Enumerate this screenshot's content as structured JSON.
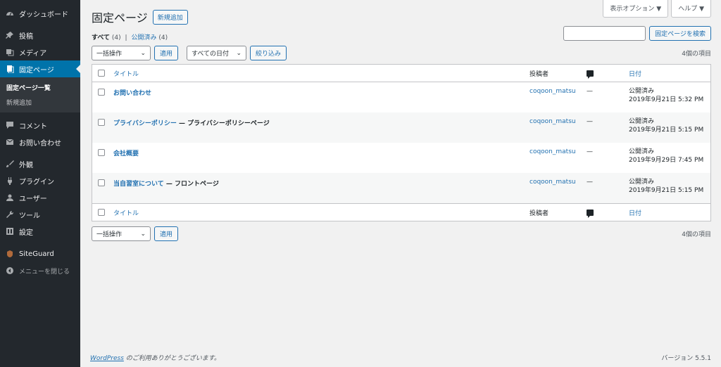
{
  "sidebar": {
    "items": [
      {
        "label": "ダッシュボード",
        "icon": "dashboard-icon"
      },
      {
        "label": "投稿",
        "icon": "pin-icon"
      },
      {
        "label": "メディア",
        "icon": "media-icon"
      },
      {
        "label": "固定ページ",
        "icon": "page-icon"
      },
      {
        "label": "コメント",
        "icon": "comment-icon"
      },
      {
        "label": "お問い合わせ",
        "icon": "mail-icon"
      },
      {
        "label": "外観",
        "icon": "brush-icon"
      },
      {
        "label": "プラグイン",
        "icon": "plugin-icon"
      },
      {
        "label": "ユーザー",
        "icon": "user-icon"
      },
      {
        "label": "ツール",
        "icon": "wrench-icon"
      },
      {
        "label": "設定",
        "icon": "settings-icon"
      },
      {
        "label": "SiteGuard",
        "icon": "siteguard-icon"
      }
    ],
    "submenu": {
      "all_pages": "固定ページ一覧",
      "add_new": "新規追加"
    },
    "collapse": "メニューを閉じる"
  },
  "header": {
    "title": "固定ページ",
    "add_new": "新規追加",
    "screen_options": "表示オプション ▼",
    "help": "ヘルプ ▼"
  },
  "filters": {
    "all": "すべて",
    "all_count": "(4)",
    "separator": "|",
    "published": "公開済み",
    "published_count": "(4)"
  },
  "search": {
    "button": "固定ページを検索",
    "value": ""
  },
  "tablenav": {
    "bulk_action": "一括操作",
    "apply": "適用",
    "all_dates": "すべての日付",
    "filter": "絞り込み",
    "items_count": "4個の項目"
  },
  "table": {
    "columns": {
      "title": "タイトル",
      "author": "投稿者",
      "date": "日付"
    },
    "rows": [
      {
        "title": "お問い合わせ",
        "state": "",
        "author": "coqoon_matsu",
        "comments": "—",
        "status": "公開済み",
        "date": "2019年9月21日 5:32 PM"
      },
      {
        "title": "プライバシーポリシー",
        "state": " — プライバシーポリシーページ",
        "author": "coqoon_matsu",
        "comments": "—",
        "status": "公開済み",
        "date": "2019年9月21日 5:15 PM"
      },
      {
        "title": "会社概要",
        "state": "",
        "author": "coqoon_matsu",
        "comments": "—",
        "status": "公開済み",
        "date": "2019年9月29日 7:45 PM"
      },
      {
        "title": "当自習室について",
        "state": " — フロントページ",
        "author": "coqoon_matsu",
        "comments": "—",
        "status": "公開済み",
        "date": "2019年9月21日 5:15 PM"
      }
    ]
  },
  "footer": {
    "wp_link": "WordPress",
    "thanks": " のご利用ありがとうございます。",
    "version": "バージョン 5.5.1"
  },
  "colors": {
    "sidebar_bg": "#23282d",
    "accent": "#0073aa",
    "link": "#2271b1"
  }
}
